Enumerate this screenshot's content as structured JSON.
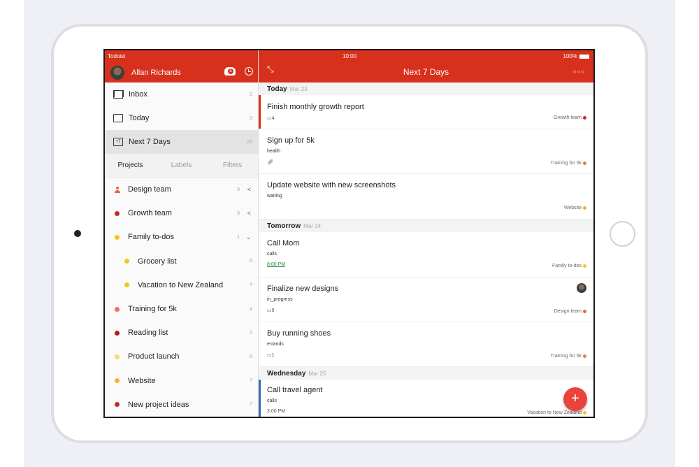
{
  "status": {
    "carrier": "Todoist",
    "time": "10:00",
    "battery": "100%"
  },
  "user": {
    "name": "Allan Richards",
    "karma_count": "5"
  },
  "nav": [
    {
      "label": "Inbox",
      "count": "2"
    },
    {
      "label": "Today",
      "count": "3"
    },
    {
      "label": "Next 7 Days",
      "count": "23"
    }
  ],
  "tabs": [
    "Projects",
    "Labels",
    "Filters"
  ],
  "projects": [
    {
      "name": "Design team",
      "count": "8",
      "color": "#e8643c",
      "arrow": "<"
    },
    {
      "name": "Growth team",
      "count": "8",
      "color": "#c62828",
      "arrow": "<"
    },
    {
      "name": "Family to-dos",
      "count": "1",
      "color": "#f5c518",
      "arrow": "⌄"
    },
    {
      "name": "Grocery list",
      "count": "6",
      "color": "#f5c518"
    },
    {
      "name": "Vacation to New Zealand",
      "count": "4",
      "color": "#f5c518"
    },
    {
      "name": "Training for 5k",
      "count": "4",
      "color": "#f07060"
    },
    {
      "name": "Reading list",
      "count": "5",
      "color": "#b71c1c"
    },
    {
      "name": "Product launch",
      "count": "8",
      "color": "#f7dc6f"
    },
    {
      "name": "Website",
      "count": "7",
      "color": "#f5b041"
    },
    {
      "name": "New project ideas",
      "count": "7",
      "color": "#c62828"
    }
  ],
  "view": {
    "title": "Next 7 Days"
  },
  "days": [
    {
      "name": "Today",
      "date": "Mar 23"
    },
    {
      "name": "Tomorrow",
      "date": "Mar 24"
    },
    {
      "name": "Wednesday",
      "date": "Mar 25"
    }
  ],
  "tasks": [
    {
      "title": "Finish monthly growth report",
      "comments": "4",
      "project": "Growth team",
      "project_color": "#c62828",
      "priority_color": "#d7301c"
    },
    {
      "title": "Sign up for 5k",
      "label": "health",
      "project": "Training for 5k",
      "project_color": "#f07060"
    },
    {
      "title": "Update website with new screenshots",
      "label": "waiting",
      "project": "Website",
      "project_color": "#f5b041"
    },
    {
      "title": "Call Mom",
      "label": "calls",
      "time": "8:00 PM",
      "project": "Family to-dos",
      "project_color": "#f5c518"
    },
    {
      "title": "Finalize new designs",
      "label": "in_progress",
      "comments": "9",
      "project": "Design team",
      "project_color": "#e8643c"
    },
    {
      "title": "Buy running shoes",
      "label": "errands",
      "comments": "1",
      "project": "Training for 5k",
      "project_color": "#f07060"
    },
    {
      "title": "Call travel agent",
      "label": "calls",
      "time": "3:00 PM",
      "project": "Vacation to New Zealand",
      "project_color": "#f5c518",
      "priority_color": "#3a6db0"
    }
  ],
  "fab": {
    "label": "+"
  },
  "colors": {
    "brand": "#d7301c"
  }
}
